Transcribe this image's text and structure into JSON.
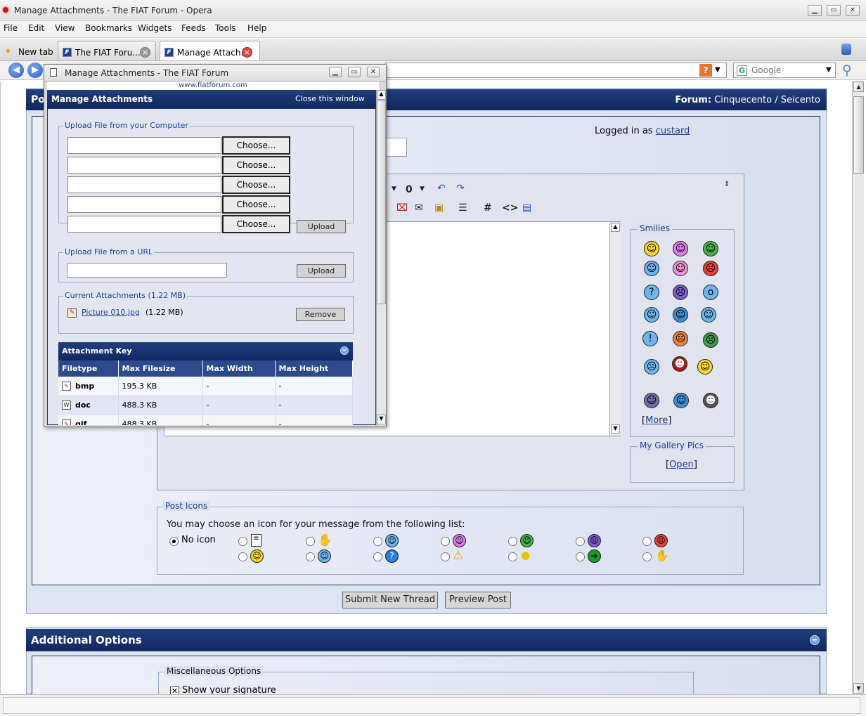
{
  "browser": {
    "title": "Manage Attachments - The FIAT Forum - Opera",
    "menu": [
      "File",
      "Edit",
      "View",
      "Bookmarks",
      "Widgets",
      "Feeds",
      "Tools",
      "Help"
    ],
    "tabs": [
      {
        "label": "New tab"
      },
      {
        "label": "The FIAT Foru..."
      },
      {
        "label": "Manage Attach..."
      }
    ],
    "search_placeholder": "Google"
  },
  "page": {
    "header_label": "Po",
    "forum_prefix": "Forum:",
    "forum_name": "Cinquecento / Seicento",
    "logged_in_prefix": "Logged in as",
    "username": "custard",
    "smilies_legend": "Smilies",
    "more_link": "More",
    "gallery_legend": "My Gallery Pics",
    "gallery_link": "Open",
    "post_icons_legend": "Post Icons",
    "post_icons_intro": "You may choose an icon for your message from the following list:",
    "no_icon_label": "No icon",
    "submit_button": "Submit New Thread",
    "preview_button": "Preview Post",
    "additional_options": "Additional Options",
    "misc_legend": "Miscellaneous Options",
    "show_signature": "Show your signature"
  },
  "popup": {
    "title": "Manage Attachments - The FIAT Forum",
    "url": "www.fiatforum.com",
    "header": "Manage Attachments",
    "close_link": "Close this window",
    "upload_computer_legend": "Upload File from your Computer",
    "choose_label": "Choose...",
    "upload_label": "Upload",
    "upload_url_legend": "Upload File from a URL",
    "current_legend": "Current Attachments (1.22 MB)",
    "attachment_name": "Picture 010.jpg",
    "attachment_size": "(1.22 MB)",
    "remove_label": "Remove",
    "key_title": "Attachment Key",
    "key_columns": [
      "Filetype",
      "Max Filesize",
      "Max Width",
      "Max Height"
    ],
    "key_rows": [
      {
        "type": "bmp",
        "size": "195.3 KB",
        "width": "-",
        "height": "-"
      },
      {
        "type": "doc",
        "size": "488.3 KB",
        "width": "-",
        "height": "-"
      },
      {
        "type": "gif",
        "size": "488.3 KB",
        "width": "-",
        "height": "-"
      }
    ]
  }
}
